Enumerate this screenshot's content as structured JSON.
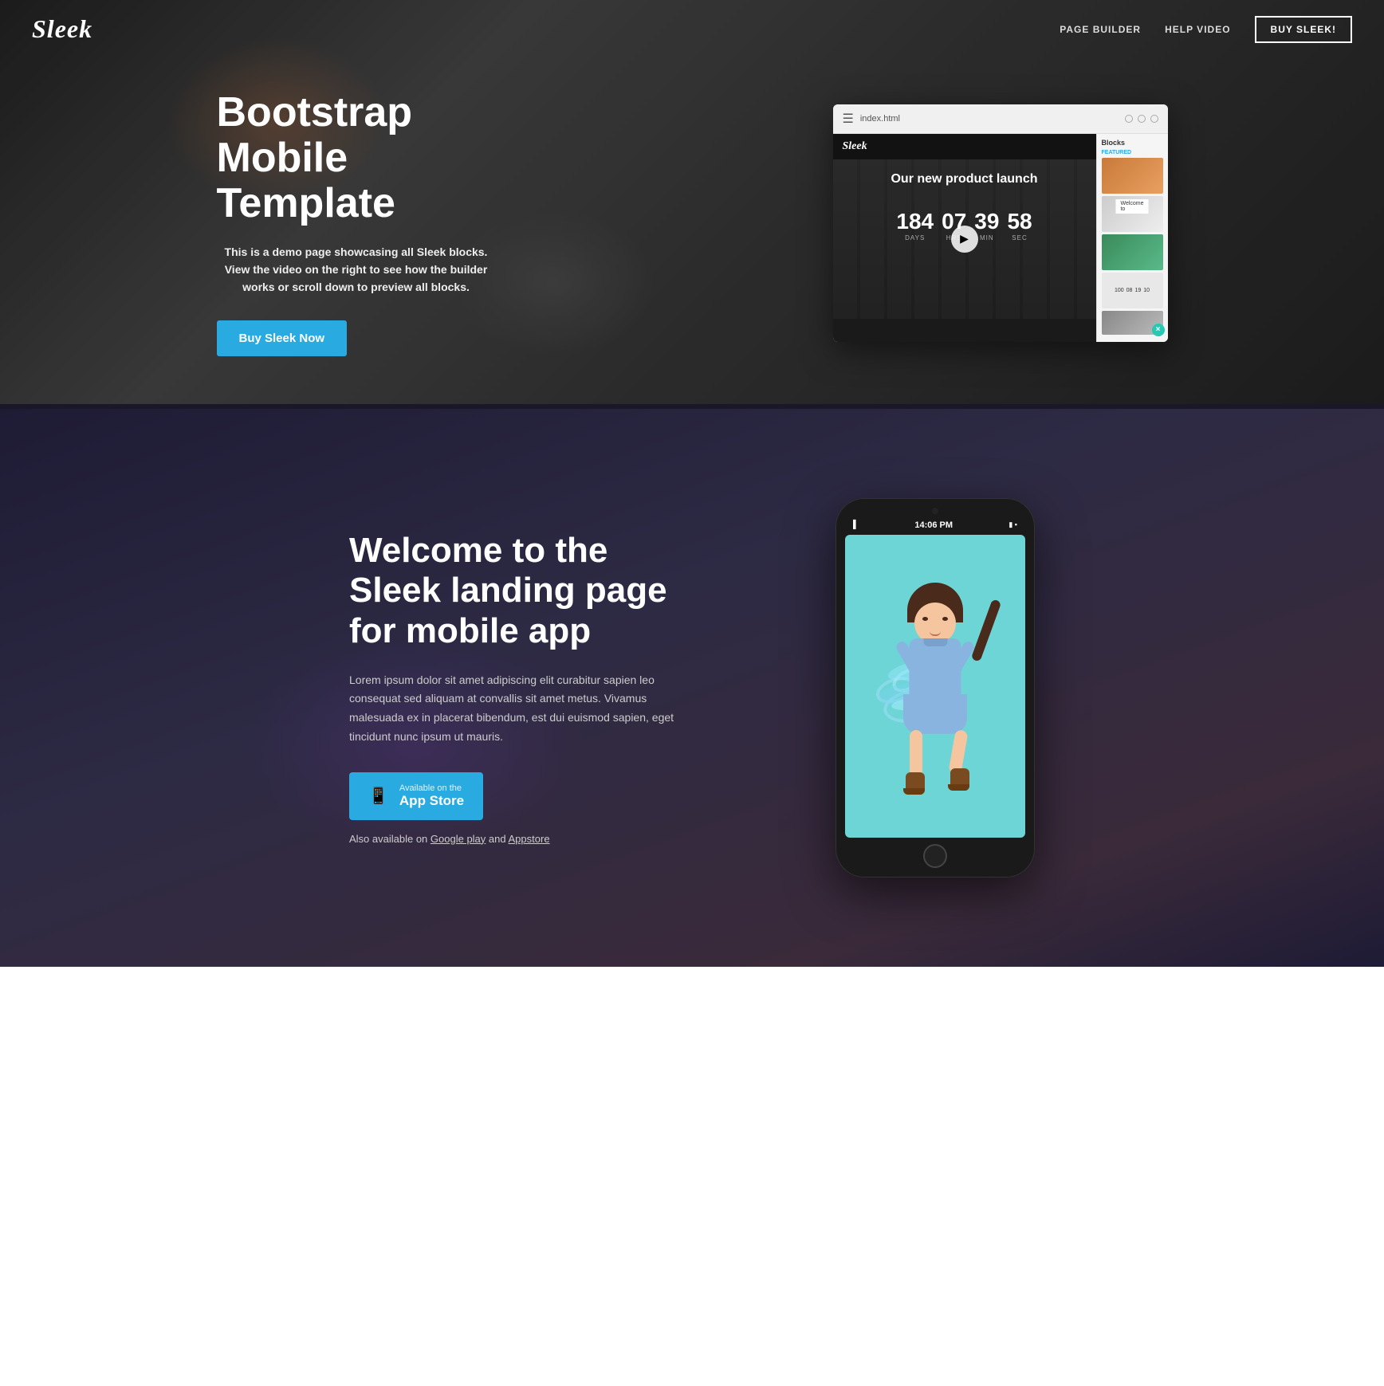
{
  "nav": {
    "logo": "Sleek",
    "links": [
      {
        "label": "PAGE BUILDER",
        "id": "page-builder"
      },
      {
        "label": "HELP VIDEO",
        "id": "help-video"
      }
    ],
    "cta_button": "BUY SLEEK!"
  },
  "hero": {
    "title": "Bootstrap Mobile Template",
    "description": "This is a demo page showcasing all Sleek blocks. View the video on the right to see how the builder works or scroll down to preview all blocks.",
    "cta_button": "Buy Sleek Now",
    "browser": {
      "url": "index.html",
      "inner_logo": "Sleek",
      "launch_text": "Our new product launch",
      "countdown": [
        {
          "num": "184",
          "label": "DAYS"
        },
        {
          "num": "07",
          "label": "HRS"
        },
        {
          "num": "39",
          "label": "MIN"
        },
        {
          "num": "58",
          "label": "SEC"
        }
      ],
      "sidebar_label": "Blocks"
    }
  },
  "app_section": {
    "title": "Welcome to the Sleek landing page for mobile app",
    "description": "Lorem ipsum dolor sit amet adipiscing elit curabitur sapien leo consequat sed aliquam at convallis sit amet metus. Vivamus malesuada ex in placerat bibendum, est dui euismod sapien, eget tincidunt nunc ipsum ut mauris.",
    "app_store_btn": {
      "subtitle": "Available on the",
      "main": "App Store"
    },
    "also_available_prefix": "Also available on ",
    "google_play_label": "Google play",
    "and_text": "and",
    "appstore_label": "Appstore"
  },
  "phone": {
    "time": "14:06 PM",
    "signal": "▌▌",
    "battery": "🔋"
  }
}
